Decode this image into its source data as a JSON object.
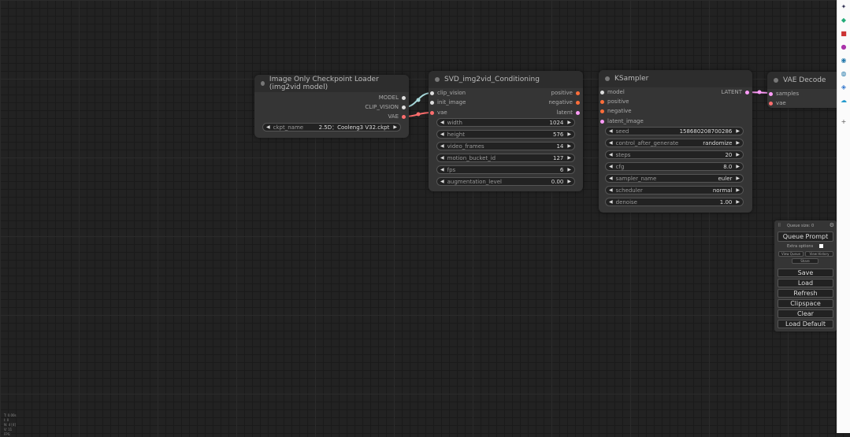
{
  "nodes": {
    "checkpoint": {
      "title": "Image Only Checkpoint Loader (img2vid model)",
      "outputs": [
        "MODEL",
        "CLIP_VISION",
        "VAE"
      ],
      "widget": {
        "label": "ckpt_name",
        "value": "2.5D：Cooleng3 V32.ckpt"
      }
    },
    "conditioning": {
      "title": "SVD_img2vid_Conditioning",
      "inputs": [
        "clip_vision",
        "init_image",
        "vae"
      ],
      "outputs": [
        "positive",
        "negative",
        "latent"
      ],
      "widgets": [
        {
          "label": "width",
          "value": "1024"
        },
        {
          "label": "height",
          "value": "576"
        },
        {
          "label": "video_frames",
          "value": "14"
        },
        {
          "label": "motion_bucket_id",
          "value": "127"
        },
        {
          "label": "fps",
          "value": "6"
        },
        {
          "label": "augmentation_level",
          "value": "0.00"
        }
      ]
    },
    "ksampler": {
      "title": "KSampler",
      "inputs": [
        "model",
        "positive",
        "negative",
        "latent_image"
      ],
      "outputs": [
        "LATENT"
      ],
      "widgets": [
        {
          "label": "seed",
          "value": "158680208700286"
        },
        {
          "label": "control_after_generate",
          "value": "randomize"
        },
        {
          "label": "steps",
          "value": "20"
        },
        {
          "label": "cfg",
          "value": "8.0"
        },
        {
          "label": "sampler_name",
          "value": "euler"
        },
        {
          "label": "scheduler",
          "value": "normal"
        },
        {
          "label": "denoise",
          "value": "1.00"
        }
      ]
    },
    "vae_decode": {
      "title": "VAE Decode",
      "inputs": [
        "samples",
        "vae"
      ]
    }
  },
  "queue_panel": {
    "title": "Queue size: 0",
    "queue_prompt": "Queue Prompt",
    "extra_options": "Extra options",
    "view_queue": "View Queue",
    "view_history": "View History",
    "share": "Share",
    "buttons": {
      "save": "Save",
      "load": "Load",
      "refresh": "Refresh",
      "clipspace": "Clipspace",
      "clear": "Clear",
      "load_default": "Load Default"
    }
  },
  "stats": [
    "T: 0.00s",
    "I: 0",
    "N: 4 [4]",
    "V: 11",
    "FPS:"
  ],
  "colors": {
    "clip_vision": "#a8dadc",
    "image": "#64b5f6",
    "vae": "#ff6e6e",
    "conditioning": "#ffa931",
    "latent": "#ff9cf9",
    "model": "#b39ddb"
  }
}
